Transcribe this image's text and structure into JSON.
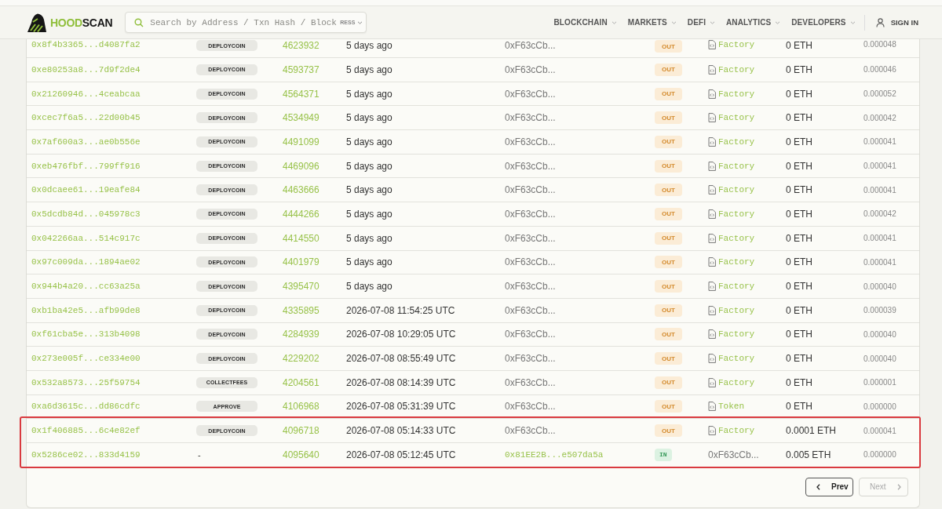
{
  "header": {
    "logo": {
      "accent": "HOOD",
      "rest": "SCAN"
    },
    "search": {
      "placeholder": "Search by Address / Txn Hash / Block",
      "filter": "RESS"
    },
    "nav": [
      {
        "label": "BLOCKCHAIN",
        "has_menu": true
      },
      {
        "label": "MARKETS",
        "has_menu": true
      },
      {
        "label": "DEFI",
        "has_menu": true
      },
      {
        "label": "ANALYTICS",
        "has_menu": true
      },
      {
        "label": "DEVELOPERS",
        "has_menu": true
      }
    ],
    "sign_in": "SIGN IN"
  },
  "table": {
    "rows": [
      {
        "hash": "0x8f4b3365...d4087fa2",
        "method": {
          "label": "DEPLOYCOIN",
          "kind": "badge"
        },
        "block": "4623932",
        "age": "5 days ago",
        "from": {
          "text": "0xF63cCb...",
          "kind": "address"
        },
        "direction": {
          "label": "OUT",
          "kind": "out"
        },
        "to": {
          "text": "Factory",
          "kind": "contract"
        },
        "value": "0 ETH",
        "fee": "0.000048",
        "highlighted": false
      },
      {
        "hash": "0xe80253a8...7d9f2de4",
        "method": {
          "label": "DEPLOYCOIN",
          "kind": "badge"
        },
        "block": "4593737",
        "age": "5 days ago",
        "from": {
          "text": "0xF63cCb...",
          "kind": "address"
        },
        "direction": {
          "label": "OUT",
          "kind": "out"
        },
        "to": {
          "text": "Factory",
          "kind": "contract"
        },
        "value": "0 ETH",
        "fee": "0.000046",
        "highlighted": false
      },
      {
        "hash": "0x21260946...4ceabcaa",
        "method": {
          "label": "DEPLOYCOIN",
          "kind": "badge"
        },
        "block": "4564371",
        "age": "5 days ago",
        "from": {
          "text": "0xF63cCb...",
          "kind": "address"
        },
        "direction": {
          "label": "OUT",
          "kind": "out"
        },
        "to": {
          "text": "Factory",
          "kind": "contract"
        },
        "value": "0 ETH",
        "fee": "0.000052",
        "highlighted": false
      },
      {
        "hash": "0xcec7f6a5...22d00b45",
        "method": {
          "label": "DEPLOYCOIN",
          "kind": "badge"
        },
        "block": "4534949",
        "age": "5 days ago",
        "from": {
          "text": "0xF63cCb...",
          "kind": "address"
        },
        "direction": {
          "label": "OUT",
          "kind": "out"
        },
        "to": {
          "text": "Factory",
          "kind": "contract"
        },
        "value": "0 ETH",
        "fee": "0.000042",
        "highlighted": false
      },
      {
        "hash": "0x7af600a3...ae0b556e",
        "method": {
          "label": "DEPLOYCOIN",
          "kind": "badge"
        },
        "block": "4491099",
        "age": "5 days ago",
        "from": {
          "text": "0xF63cCb...",
          "kind": "address"
        },
        "direction": {
          "label": "OUT",
          "kind": "out"
        },
        "to": {
          "text": "Factory",
          "kind": "contract"
        },
        "value": "0 ETH",
        "fee": "0.000041",
        "highlighted": false
      },
      {
        "hash": "0xeb476fbf...799ff916",
        "method": {
          "label": "DEPLOYCOIN",
          "kind": "badge"
        },
        "block": "4469096",
        "age": "5 days ago",
        "from": {
          "text": "0xF63cCb...",
          "kind": "address"
        },
        "direction": {
          "label": "OUT",
          "kind": "out"
        },
        "to": {
          "text": "Factory",
          "kind": "contract"
        },
        "value": "0 ETH",
        "fee": "0.000041",
        "highlighted": false
      },
      {
        "hash": "0x0dcaee61...19eafe84",
        "method": {
          "label": "DEPLOYCOIN",
          "kind": "badge"
        },
        "block": "4463666",
        "age": "5 days ago",
        "from": {
          "text": "0xF63cCb...",
          "kind": "address"
        },
        "direction": {
          "label": "OUT",
          "kind": "out"
        },
        "to": {
          "text": "Factory",
          "kind": "contract"
        },
        "value": "0 ETH",
        "fee": "0.000041",
        "highlighted": false
      },
      {
        "hash": "0x5dcdb84d...045978c3",
        "method": {
          "label": "DEPLOYCOIN",
          "kind": "badge"
        },
        "block": "4444266",
        "age": "5 days ago",
        "from": {
          "text": "0xF63cCb...",
          "kind": "address"
        },
        "direction": {
          "label": "OUT",
          "kind": "out"
        },
        "to": {
          "text": "Factory",
          "kind": "contract"
        },
        "value": "0 ETH",
        "fee": "0.000042",
        "highlighted": false
      },
      {
        "hash": "0x042266aa...514c917c",
        "method": {
          "label": "DEPLOYCOIN",
          "kind": "badge"
        },
        "block": "4414550",
        "age": "5 days ago",
        "from": {
          "text": "0xF63cCb...",
          "kind": "address"
        },
        "direction": {
          "label": "OUT",
          "kind": "out"
        },
        "to": {
          "text": "Factory",
          "kind": "contract"
        },
        "value": "0 ETH",
        "fee": "0.000041",
        "highlighted": false
      },
      {
        "hash": "0x97c009da...1894ae02",
        "method": {
          "label": "DEPLOYCOIN",
          "kind": "badge"
        },
        "block": "4401979",
        "age": "5 days ago",
        "from": {
          "text": "0xF63cCb...",
          "kind": "address"
        },
        "direction": {
          "label": "OUT",
          "kind": "out"
        },
        "to": {
          "text": "Factory",
          "kind": "contract"
        },
        "value": "0 ETH",
        "fee": "0.000041",
        "highlighted": false
      },
      {
        "hash": "0x944b4a20...cc63a25a",
        "method": {
          "label": "DEPLOYCOIN",
          "kind": "badge"
        },
        "block": "4395470",
        "age": "5 days ago",
        "from": {
          "text": "0xF63cCb...",
          "kind": "address"
        },
        "direction": {
          "label": "OUT",
          "kind": "out"
        },
        "to": {
          "text": "Factory",
          "kind": "contract"
        },
        "value": "0 ETH",
        "fee": "0.000040",
        "highlighted": false
      },
      {
        "hash": "0xb1ba42e5...afb99de8",
        "method": {
          "label": "DEPLOYCOIN",
          "kind": "badge"
        },
        "block": "4335895",
        "age": "2026-07-08 11:54:25 UTC",
        "from": {
          "text": "0xF63cCb...",
          "kind": "address"
        },
        "direction": {
          "label": "OUT",
          "kind": "out"
        },
        "to": {
          "text": "Factory",
          "kind": "contract"
        },
        "value": "0 ETH",
        "fee": "0.000039",
        "highlighted": false
      },
      {
        "hash": "0xf61cba5e...313b4098",
        "method": {
          "label": "DEPLOYCOIN",
          "kind": "badge"
        },
        "block": "4284939",
        "age": "2026-07-08 10:29:05 UTC",
        "from": {
          "text": "0xF63cCb...",
          "kind": "address"
        },
        "direction": {
          "label": "OUT",
          "kind": "out"
        },
        "to": {
          "text": "Factory",
          "kind": "contract"
        },
        "value": "0 ETH",
        "fee": "0.000040",
        "highlighted": false
      },
      {
        "hash": "0x273e005f...ce334e00",
        "method": {
          "label": "DEPLOYCOIN",
          "kind": "badge"
        },
        "block": "4229202",
        "age": "2026-07-08 08:55:49 UTC",
        "from": {
          "text": "0xF63cCb...",
          "kind": "address"
        },
        "direction": {
          "label": "OUT",
          "kind": "out"
        },
        "to": {
          "text": "Factory",
          "kind": "contract"
        },
        "value": "0 ETH",
        "fee": "0.000040",
        "highlighted": false
      },
      {
        "hash": "0x532a8573...25f59754",
        "method": {
          "label": "COLLECTFEES",
          "kind": "badge"
        },
        "block": "4204561",
        "age": "2026-07-08 08:14:39 UTC",
        "from": {
          "text": "0xF63cCb...",
          "kind": "address"
        },
        "direction": {
          "label": "OUT",
          "kind": "out"
        },
        "to": {
          "text": "Factory",
          "kind": "contract"
        },
        "value": "0 ETH",
        "fee": "0.000001",
        "highlighted": false
      },
      {
        "hash": "0xa6d3615c...dd86cdfc",
        "method": {
          "label": "APPROVE",
          "kind": "badge"
        },
        "block": "4106968",
        "age": "2026-07-08 05:31:39 UTC",
        "from": {
          "text": "0xF63cCb...",
          "kind": "address"
        },
        "direction": {
          "label": "OUT",
          "kind": "out"
        },
        "to": {
          "text": "Token",
          "kind": "contract"
        },
        "value": "0 ETH",
        "fee": "0.000000",
        "highlighted": false
      },
      {
        "hash": "0x1f406885...6c4e82ef",
        "method": {
          "label": "DEPLOYCOIN",
          "kind": "badge"
        },
        "block": "4096718",
        "age": "2026-07-08 05:14:33 UTC",
        "from": {
          "text": "0xF63cCb...",
          "kind": "address"
        },
        "direction": {
          "label": "OUT",
          "kind": "out"
        },
        "to": {
          "text": "Factory",
          "kind": "contract"
        },
        "value": "0.0001 ETH",
        "fee": "0.000041",
        "highlighted": true
      },
      {
        "hash": "0x5286ce02...833d4159",
        "method": {
          "label": "-",
          "kind": "plain"
        },
        "block": "4095640",
        "age": "2026-07-08 05:12:45 UTC",
        "from": {
          "text": "0x81EE2B...e507da5a",
          "kind": "link"
        },
        "direction": {
          "label": "IN",
          "kind": "in"
        },
        "to": {
          "text": "0xF63cCb...",
          "kind": "address"
        },
        "value": "0.005 ETH",
        "fee": "0.000000",
        "highlighted": true
      }
    ]
  },
  "pagination": [
    {
      "label": "Prev",
      "kind": "prev",
      "disabled": false
    },
    {
      "label": "Next",
      "kind": "next",
      "disabled": true
    }
  ]
}
